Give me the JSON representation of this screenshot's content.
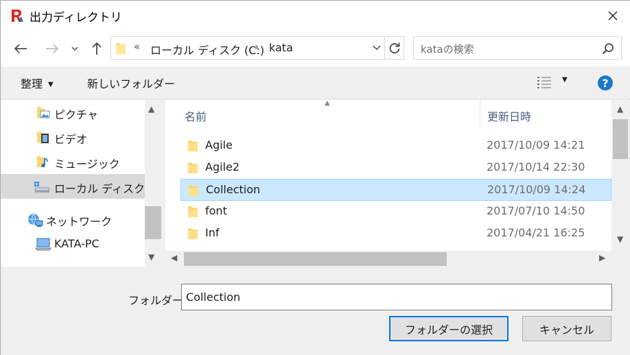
{
  "window": {
    "title": "出力ディレクトリ",
    "close_glyph": "✕"
  },
  "address": {
    "overflow": "«",
    "crumbs": [
      "ローカル ディスク (C:)",
      "kata"
    ],
    "separator": "›"
  },
  "search": {
    "placeholder": "kataの検索"
  },
  "toolbar": {
    "organize_label": "整理",
    "new_folder_label": "新しいフォルダー",
    "help_glyph": "?"
  },
  "nav_pane": {
    "items": [
      {
        "label": "ピクチャ",
        "icon": "pictures-folder-icon"
      },
      {
        "label": "ビデオ",
        "icon": "videos-folder-icon"
      },
      {
        "label": "ミュージック",
        "icon": "music-folder-icon"
      },
      {
        "label": "ローカル ディスク (C:)",
        "icon": "local-disk-icon",
        "selected": true
      },
      {
        "label": "ネットワーク",
        "icon": "network-icon"
      },
      {
        "label": "KATA-PC",
        "icon": "computer-icon"
      }
    ]
  },
  "file_list": {
    "columns": {
      "name": "名前",
      "modified": "更新日時"
    },
    "rows": [
      {
        "name": "Agile",
        "modified": "2017/10/09 14:21"
      },
      {
        "name": "Agile2",
        "modified": "2017/10/14 22:30"
      },
      {
        "name": "Collection",
        "modified": "2017/10/09 14:24",
        "selected": true
      },
      {
        "name": "font",
        "modified": "2017/07/10 14:50"
      },
      {
        "name": "Inf",
        "modified": "2017/04/21 16:25"
      }
    ]
  },
  "footer": {
    "folder_label": "フォルダー:",
    "folder_value": "Collection",
    "select_button": "フォルダーの選択",
    "cancel_button": "キャンセル"
  },
  "colors": {
    "accent": "#0078d7",
    "selection": "#cce8ff",
    "folder": "#f8d775"
  }
}
